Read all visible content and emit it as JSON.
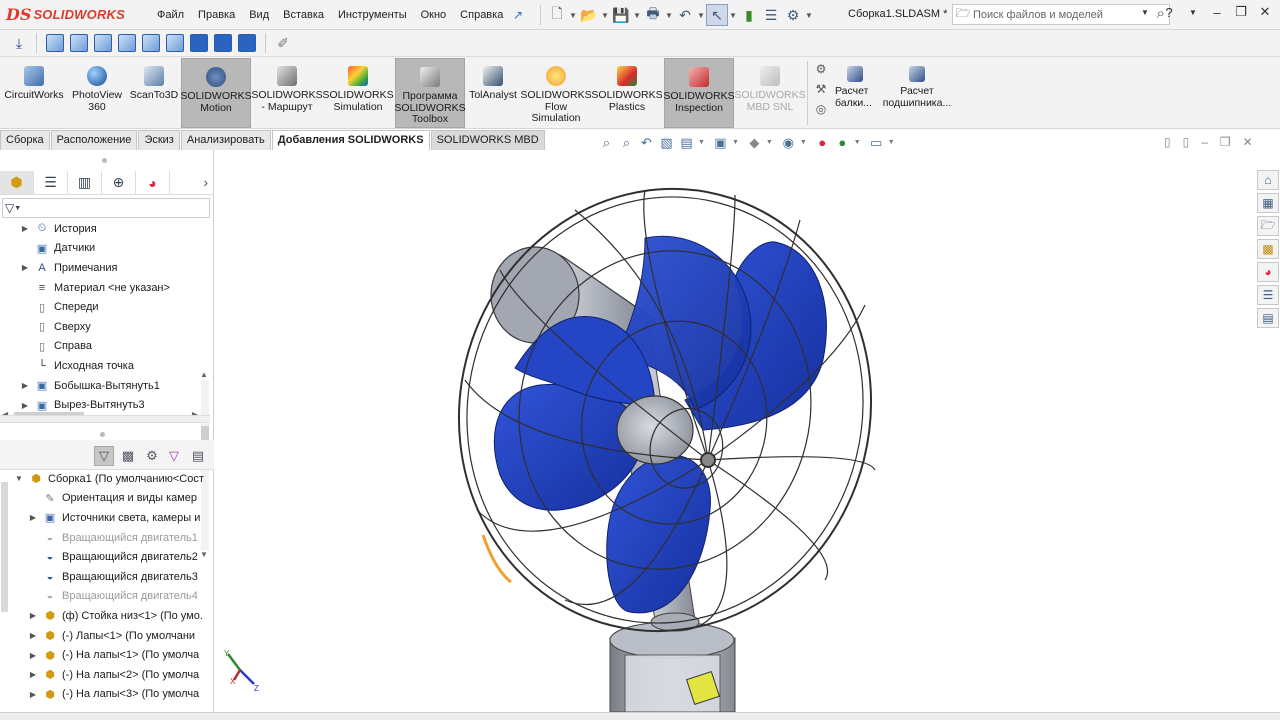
{
  "app": {
    "brand": "SOLIDWORKS",
    "brand_prefix": "DS",
    "document_title": "Сборка1.SLDASM *"
  },
  "menu": [
    "Файл",
    "Правка",
    "Вид",
    "Вставка",
    "Инструменты",
    "Окно",
    "Справка"
  ],
  "search": {
    "placeholder": "Поиск файлов и моделей"
  },
  "ribbon": {
    "buttons": [
      {
        "label": "CircuitWorks",
        "state": "normal"
      },
      {
        "label": "PhotoView 360",
        "state": "normal"
      },
      {
        "label": "ScanTo3D",
        "state": "normal"
      },
      {
        "label": "SOLIDWORKS Motion",
        "state": "active"
      },
      {
        "label": "SOLIDWORKS - Маршрут",
        "state": "normal"
      },
      {
        "label": "SOLIDWORKS Simulation",
        "state": "normal"
      },
      {
        "label": "Программа SOLIDWORKS Toolbox",
        "state": "active"
      },
      {
        "label": "TolAnalyst",
        "state": "normal"
      },
      {
        "label": "SOLIDWORKS Flow Simulation",
        "state": "normal"
      },
      {
        "label": "SOLIDWORKS Plastics",
        "state": "normal"
      },
      {
        "label": "SOLIDWORKS Inspection",
        "state": "active"
      },
      {
        "label": "SOLIDWORKS MBD SNL",
        "state": "disabled"
      }
    ],
    "small": [
      {
        "label": "Расчет балки..."
      },
      {
        "label": "Расчет подшипника..."
      }
    ]
  },
  "tabs": [
    {
      "label": "Сборка",
      "active": false
    },
    {
      "label": "Расположение",
      "active": false
    },
    {
      "label": "Эскиз",
      "active": false
    },
    {
      "label": "Анализировать",
      "active": false
    },
    {
      "label": "Добавления SOLIDWORKS",
      "active": true
    },
    {
      "label": "SOLIDWORKS MBD",
      "active": false
    }
  ],
  "feature_tree_top": [
    {
      "label": "История",
      "icon": "history-icon",
      "expandable": true
    },
    {
      "label": "Датчики",
      "icon": "sensor-icon",
      "expandable": false
    },
    {
      "label": "Примечания",
      "icon": "annotation-icon",
      "expandable": true
    },
    {
      "label": "Материал <не указан>",
      "icon": "material-icon",
      "expandable": false
    },
    {
      "label": "Спереди",
      "icon": "plane-icon",
      "expandable": false
    },
    {
      "label": "Сверху",
      "icon": "plane-icon",
      "expandable": false
    },
    {
      "label": "Справа",
      "icon": "plane-icon",
      "expandable": false
    },
    {
      "label": "Исходная точка",
      "icon": "origin-icon",
      "expandable": false
    },
    {
      "label": "Бобышка-Вытянуть1",
      "icon": "extrude-icon",
      "expandable": true
    },
    {
      "label": "Вырез-Вытянуть3",
      "icon": "cut-icon",
      "expandable": true
    }
  ],
  "motion_tree": [
    {
      "label": "Сборка1  (По умолчанию<Сост",
      "icon": "assembly-icon",
      "level": 0,
      "expandable": true,
      "greyed": false
    },
    {
      "label": "Ориентация и виды камер",
      "icon": "camera-view-icon",
      "level": 1,
      "expandable": false,
      "greyed": false
    },
    {
      "label": "Источники света, камеры и",
      "icon": "lights-icon",
      "level": 1,
      "expandable": true,
      "greyed": false
    },
    {
      "label": "Вращающийся двигатель1",
      "icon": "rotary-motor-icon",
      "level": 1,
      "expandable": false,
      "greyed": true
    },
    {
      "label": "Вращающийся двигатель2",
      "icon": "rotary-motor-icon",
      "level": 1,
      "expandable": false,
      "greyed": false
    },
    {
      "label": "Вращающийся двигатель3",
      "icon": "rotary-motor-icon",
      "level": 1,
      "expandable": false,
      "greyed": false
    },
    {
      "label": "Вращающийся двигатель4",
      "icon": "rotary-motor-icon",
      "level": 1,
      "expandable": false,
      "greyed": true
    },
    {
      "label": "(ф) Стойка низ<1> (По умо.",
      "icon": "part-icon",
      "level": 1,
      "expandable": true,
      "greyed": false
    },
    {
      "label": "(-) Лапы<1> (По умолчани",
      "icon": "part-icon",
      "level": 1,
      "expandable": true,
      "greyed": false
    },
    {
      "label": "(-) На лапы<1> (По умолча",
      "icon": "part-icon",
      "level": 1,
      "expandable": true,
      "greyed": false
    },
    {
      "label": "(-) На лапы<2> (По умолча",
      "icon": "part-icon",
      "level": 1,
      "expandable": true,
      "greyed": false
    },
    {
      "label": "(-) На лапы<3> (По умолча",
      "icon": "part-icon",
      "level": 1,
      "expandable": true,
      "greyed": false
    }
  ],
  "colors": {
    "blade_blue": "#1f3fb8",
    "motor_grey": "#9aa0ab",
    "cage": "#3a3a3a",
    "accent_orange": "#f0a030",
    "label_yellow": "#e6e84a"
  }
}
